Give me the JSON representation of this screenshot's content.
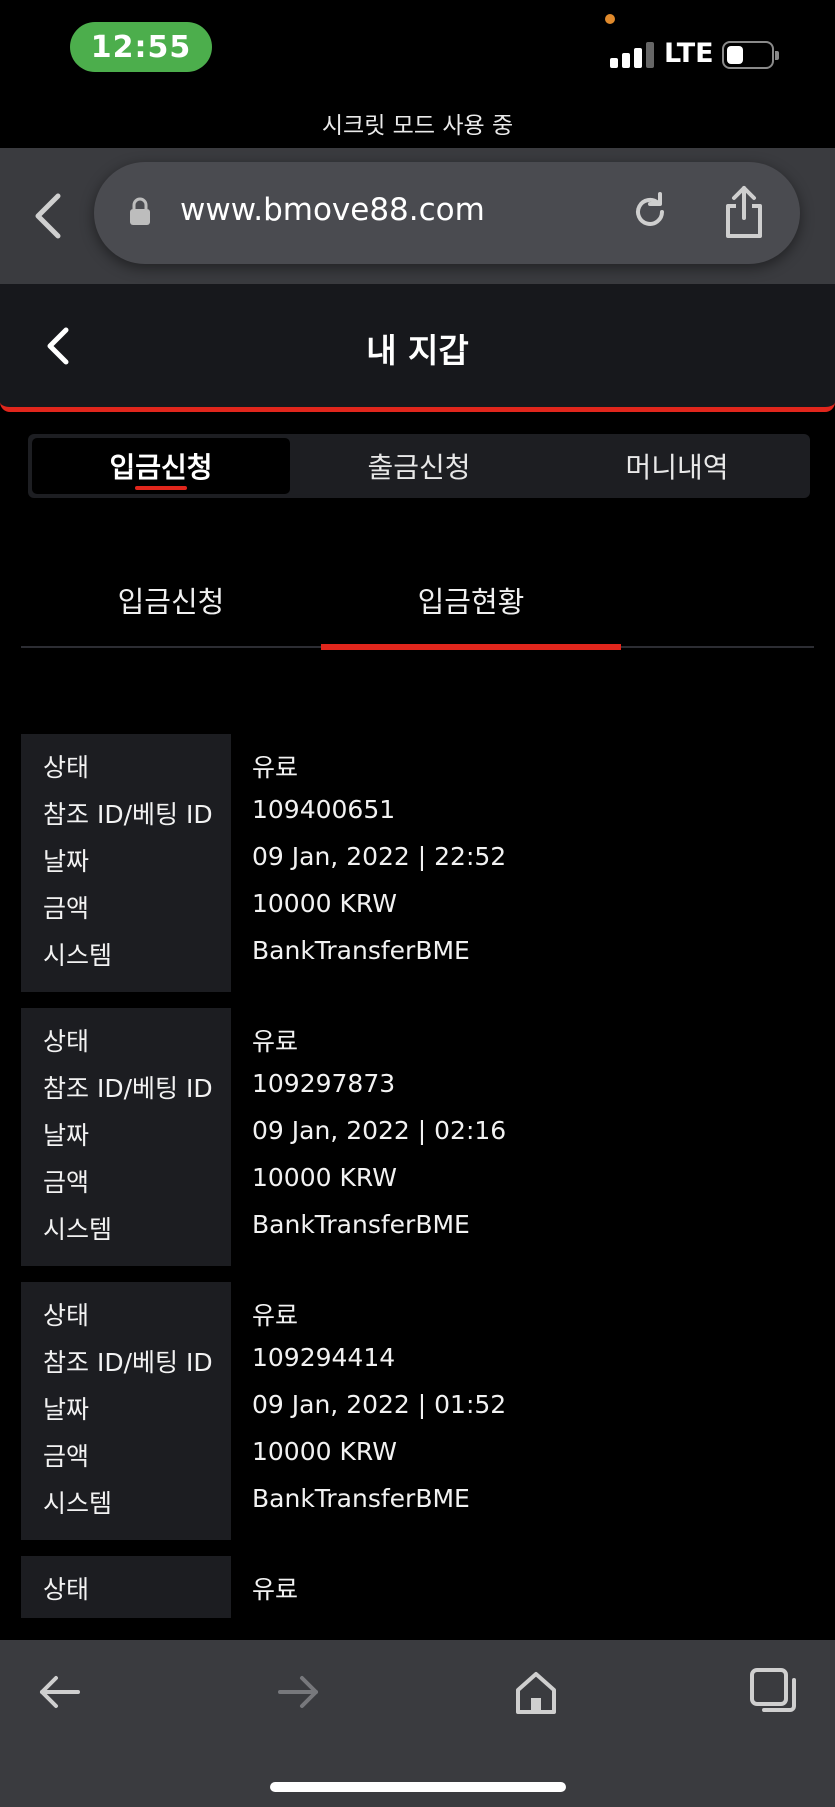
{
  "status_bar": {
    "time": "12:55",
    "network": "LTE"
  },
  "browser": {
    "incognito_text": "시크릿 모드 사용 중",
    "url": "www.bmove88.com"
  },
  "header": {
    "title": "내 지갑"
  },
  "tabs": [
    {
      "label": "입금신청",
      "active": true
    },
    {
      "label": "출금신청",
      "active": false
    },
    {
      "label": "머니내역",
      "active": false
    }
  ],
  "sub_tabs": [
    {
      "label": "입금신청",
      "active": false
    },
    {
      "label": "입금현황",
      "active": true
    }
  ],
  "labels": {
    "status": "상태",
    "ref_id": "참조 ID/베팅 ID",
    "date": "날짜",
    "amount": "금액",
    "system": "시스템"
  },
  "records": [
    {
      "status": "유료",
      "ref_id": "109400651",
      "date": "09 Jan, 2022 | 22:52",
      "amount": "10000 KRW",
      "system": "BankTransferBME"
    },
    {
      "status": "유료",
      "ref_id": "109297873",
      "date": "09 Jan, 2022 | 02:16",
      "amount": "10000 KRW",
      "system": "BankTransferBME"
    },
    {
      "status": "유료",
      "ref_id": "109294414",
      "date": "09 Jan, 2022 | 01:52",
      "amount": "10000 KRW",
      "system": "BankTransferBME"
    },
    {
      "status": "유료"
    }
  ],
  "icons": {
    "browser_back": "chevron-left-icon",
    "lock": "lock-icon",
    "reload": "reload-icon",
    "share": "share-icon",
    "toolbar": [
      "arrow-left-icon",
      "arrow-right-icon",
      "home-icon",
      "tabs-icon"
    ]
  },
  "colors": {
    "accent": "#e1261c",
    "time_pill": "#4cae4c",
    "header_bg": "#17181c",
    "chrome_bg": "#3a3b3f"
  }
}
